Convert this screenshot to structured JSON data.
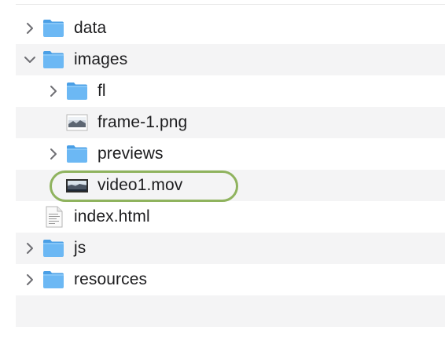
{
  "file_browser": {
    "items": [
      {
        "name": "data",
        "kind": "folder",
        "expanded": false,
        "level": 0
      },
      {
        "name": "images",
        "kind": "folder",
        "expanded": true,
        "level": 0
      },
      {
        "name": "fl",
        "kind": "folder",
        "expanded": false,
        "level": 1
      },
      {
        "name": "frame-1.png",
        "kind": "image-file",
        "level": 1
      },
      {
        "name": "previews",
        "kind": "folder",
        "expanded": false,
        "level": 1
      },
      {
        "name": "video1.mov",
        "kind": "video-file",
        "level": 1,
        "highlighted": true
      },
      {
        "name": "index.html",
        "kind": "html-file",
        "level": 0
      },
      {
        "name": "js",
        "kind": "folder",
        "expanded": false,
        "level": 0
      },
      {
        "name": "resources",
        "kind": "folder",
        "expanded": false,
        "level": 0
      }
    ]
  },
  "colors": {
    "folder": "#5aaef0",
    "stripe": "#f4f4f5",
    "highlight_ring": "#8fb35e",
    "chevron": "#6e6e73"
  }
}
